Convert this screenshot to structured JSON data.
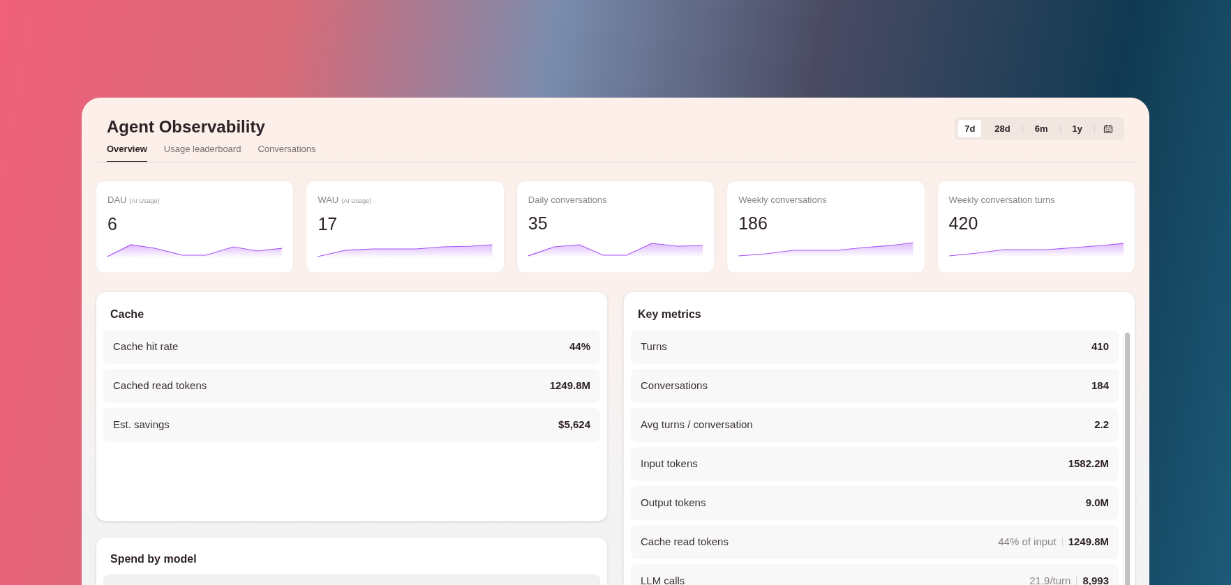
{
  "window": {
    "title": "Agent Observability"
  },
  "tabs": [
    {
      "label": "Overview",
      "selected": true
    },
    {
      "label": "Usage leaderboard",
      "selected": false
    },
    {
      "label": "Conversations",
      "selected": false
    }
  ],
  "range": [
    {
      "label": "7d",
      "selected": true
    },
    {
      "label": "28d",
      "selected": false
    },
    {
      "label": "6m",
      "selected": false
    },
    {
      "label": "1y",
      "selected": false
    }
  ],
  "stat_cards": [
    {
      "label": "DAU",
      "note": "(AI Usage)",
      "value": "6"
    },
    {
      "label": "WAU",
      "note": "(AI Usage)",
      "value": "17"
    },
    {
      "label": "Daily conversations",
      "value": "35"
    },
    {
      "label": "Weekly conversations",
      "value": "186"
    },
    {
      "label": "Weekly conversation turns",
      "value": "420"
    }
  ],
  "cache": {
    "title": "Cache",
    "rows": [
      {
        "label": "Cache hit rate",
        "value": "44%"
      },
      {
        "label": "Cached read tokens",
        "value": "1249.8M"
      },
      {
        "label": "Est. savings",
        "value": "$5,624"
      }
    ]
  },
  "spend_by_model": {
    "title": "Spend by model"
  },
  "key_metrics": {
    "title": "Key metrics",
    "rows": [
      {
        "label": "Turns",
        "value": "410"
      },
      {
        "label": "Conversations",
        "value": "184"
      },
      {
        "label": "Avg turns / conversation",
        "value": "2.2"
      },
      {
        "label": "Input tokens",
        "value": "1582.2M"
      },
      {
        "label": "Output tokens",
        "value": "9.0M"
      },
      {
        "label": "Cache read tokens",
        "detail": "44% of input",
        "value": "1249.8M"
      },
      {
        "label": "LLM calls",
        "detail": "21.9/turn",
        "value": "8,993"
      }
    ]
  }
}
